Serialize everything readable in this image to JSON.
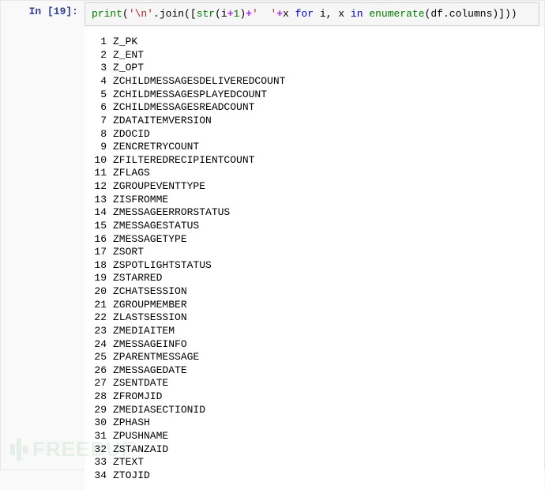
{
  "prompt": {
    "label": "In [19]:"
  },
  "code": {
    "tokens": [
      {
        "t": "print",
        "c": "kw-builtin"
      },
      {
        "t": "(",
        "c": "paren"
      },
      {
        "t": "'\\n'",
        "c": "kw-str"
      },
      {
        "t": ".",
        "c": "paren"
      },
      {
        "t": "join",
        "c": "kw-name"
      },
      {
        "t": "([",
        "c": "paren"
      },
      {
        "t": "str",
        "c": "kw-builtin"
      },
      {
        "t": "(",
        "c": "paren"
      },
      {
        "t": "i",
        "c": "kw-name"
      },
      {
        "t": "+",
        "c": "kw-op"
      },
      {
        "t": "1",
        "c": "kw-num"
      },
      {
        "t": ")",
        "c": "paren"
      },
      {
        "t": "+",
        "c": "kw-op"
      },
      {
        "t": "'  '",
        "c": "kw-str"
      },
      {
        "t": "+",
        "c": "kw-op"
      },
      {
        "t": "x",
        "c": "kw-name"
      },
      {
        "t": " ",
        "c": "paren"
      },
      {
        "t": "for",
        "c": "kw-func"
      },
      {
        "t": " ",
        "c": "paren"
      },
      {
        "t": "i",
        "c": "kw-name"
      },
      {
        "t": ", ",
        "c": "paren"
      },
      {
        "t": "x",
        "c": "kw-name"
      },
      {
        "t": " ",
        "c": "paren"
      },
      {
        "t": "in",
        "c": "kw-func"
      },
      {
        "t": " ",
        "c": "paren"
      },
      {
        "t": "enumerate",
        "c": "kw-builtin"
      },
      {
        "t": "(",
        "c": "paren"
      },
      {
        "t": "df",
        "c": "kw-name"
      },
      {
        "t": ".",
        "c": "paren"
      },
      {
        "t": "columns",
        "c": "kw-name"
      },
      {
        "t": ")]))",
        "c": "paren"
      }
    ]
  },
  "output": {
    "lines": [
      {
        "n": "1",
        "v": "Z_PK"
      },
      {
        "n": "2",
        "v": "Z_ENT"
      },
      {
        "n": "3",
        "v": "Z_OPT"
      },
      {
        "n": "4",
        "v": "ZCHILDMESSAGESDELIVEREDCOUNT"
      },
      {
        "n": "5",
        "v": "ZCHILDMESSAGESPLAYEDCOUNT"
      },
      {
        "n": "6",
        "v": "ZCHILDMESSAGESREADCOUNT"
      },
      {
        "n": "7",
        "v": "ZDATAITEMVERSION"
      },
      {
        "n": "8",
        "v": "ZDOCID"
      },
      {
        "n": "9",
        "v": "ZENCRETRYCOUNT"
      },
      {
        "n": "10",
        "v": "ZFILTEREDRECIPIENTCOUNT"
      },
      {
        "n": "11",
        "v": "ZFLAGS"
      },
      {
        "n": "12",
        "v": "ZGROUPEVENTTYPE"
      },
      {
        "n": "13",
        "v": "ZISFROMME"
      },
      {
        "n": "14",
        "v": "ZMESSAGEERRORSTATUS"
      },
      {
        "n": "15",
        "v": "ZMESSAGESTATUS"
      },
      {
        "n": "16",
        "v": "ZMESSAGETYPE"
      },
      {
        "n": "17",
        "v": "ZSORT"
      },
      {
        "n": "18",
        "v": "ZSPOTLIGHTSTATUS"
      },
      {
        "n": "19",
        "v": "ZSTARRED"
      },
      {
        "n": "20",
        "v": "ZCHATSESSION"
      },
      {
        "n": "21",
        "v": "ZGROUPMEMBER"
      },
      {
        "n": "22",
        "v": "ZLASTSESSION"
      },
      {
        "n": "23",
        "v": "ZMEDIAITEM"
      },
      {
        "n": "24",
        "v": "ZMESSAGEINFO"
      },
      {
        "n": "25",
        "v": "ZPARENTMESSAGE"
      },
      {
        "n": "26",
        "v": "ZMESSAGEDATE"
      },
      {
        "n": "27",
        "v": "ZSENTDATE"
      },
      {
        "n": "28",
        "v": "ZFROMJID"
      },
      {
        "n": "29",
        "v": "ZMEDIASECTIONID"
      },
      {
        "n": "30",
        "v": "ZPHASH"
      },
      {
        "n": "31",
        "v": "ZPUSHNAME"
      },
      {
        "n": "32",
        "v": "ZSTANZAID"
      },
      {
        "n": "33",
        "v": "ZTEXT"
      },
      {
        "n": "34",
        "v": "ZTOJID"
      }
    ]
  },
  "watermark": {
    "text": "FREEBUF"
  }
}
